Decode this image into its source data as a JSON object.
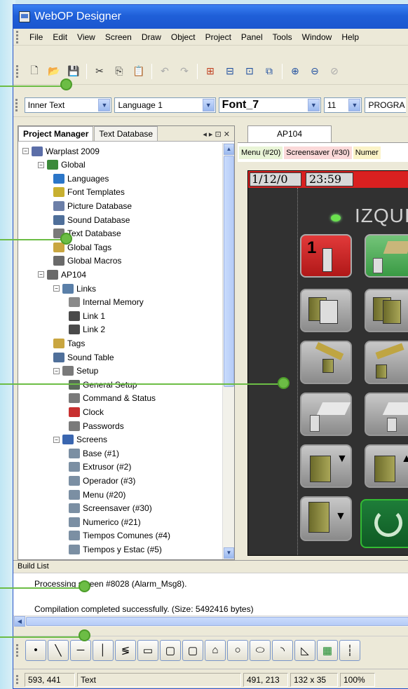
{
  "window": {
    "title": "WebOP Designer"
  },
  "menu": [
    "File",
    "Edit",
    "View",
    "Screen",
    "Draw",
    "Object",
    "Project",
    "Panel",
    "Tools",
    "Window",
    "Help"
  ],
  "format_toolbar": {
    "field_combo": "Inner Text",
    "language_combo": "Language 1",
    "font_combo": "Font_7",
    "size_combo": "11",
    "extra_combo": "PROGRA"
  },
  "project_manager": {
    "tabs": [
      "Project Manager",
      "Text Database"
    ],
    "controls": "◂ ▸ ⊡ ✕",
    "tree": [
      {
        "label": "Warplast 2009",
        "level": 0,
        "expander": "−",
        "icon_color": "#5b6ea8"
      },
      {
        "label": "Global",
        "level": 1,
        "expander": "−",
        "icon_color": "#3b8a3a"
      },
      {
        "label": "Languages",
        "level": 2,
        "expander": "",
        "icon_color": "#2b76c8"
      },
      {
        "label": "Font Templates",
        "level": 2,
        "expander": "",
        "icon_color": "#c8b030"
      },
      {
        "label": "Picture Database",
        "level": 2,
        "expander": "",
        "icon_color": "#6c7fa8"
      },
      {
        "label": "Sound Database",
        "level": 2,
        "expander": "",
        "icon_color": "#4f6f9a"
      },
      {
        "label": "Text Database",
        "level": 2,
        "expander": "",
        "icon_color": "#7a7a7a"
      },
      {
        "label": "Global Tags",
        "level": 2,
        "expander": "",
        "icon_color": "#c9a640"
      },
      {
        "label": "Global Macros",
        "level": 2,
        "expander": "",
        "icon_color": "#6a6a6a"
      },
      {
        "label": "AP104",
        "level": 1,
        "expander": "−",
        "icon_color": "#6a6a6a"
      },
      {
        "label": "Links",
        "level": 2,
        "expander": "−",
        "icon_color": "#5a7fa8"
      },
      {
        "label": "Internal Memory",
        "level": 3,
        "expander": "",
        "icon_color": "#8a8a8a"
      },
      {
        "label": "Link 1",
        "level": 3,
        "expander": "",
        "icon_color": "#4a4a4a"
      },
      {
        "label": "Link 2",
        "level": 3,
        "expander": "",
        "icon_color": "#4a4a4a"
      },
      {
        "label": "Tags",
        "level": 2,
        "expander": "",
        "icon_color": "#c9a640"
      },
      {
        "label": "Sound Table",
        "level": 2,
        "expander": "",
        "icon_color": "#4f6f9a"
      },
      {
        "label": "Setup",
        "level": 2,
        "expander": "−",
        "icon_color": "#7a7a7a"
      },
      {
        "label": "General Setup",
        "level": 3,
        "expander": "",
        "icon_color": "#5a6a5a"
      },
      {
        "label": "Command & Status",
        "level": 3,
        "expander": "",
        "icon_color": "#7a7a7a"
      },
      {
        "label": "Clock",
        "level": 3,
        "expander": "",
        "icon_color": "#c83030"
      },
      {
        "label": "Passwords",
        "level": 3,
        "expander": "",
        "icon_color": "#7a7a7a"
      },
      {
        "label": "Screens",
        "level": 2,
        "expander": "−",
        "icon_color": "#3a66b0"
      },
      {
        "label": "Base (#1)",
        "level": 3,
        "expander": "",
        "icon_color": "#7b8fa3"
      },
      {
        "label": "Extrusor (#2)",
        "level": 3,
        "expander": "",
        "icon_color": "#7b8fa3"
      },
      {
        "label": "Operador (#3)",
        "level": 3,
        "expander": "",
        "icon_color": "#7b8fa3"
      },
      {
        "label": "Menu (#20)",
        "level": 3,
        "expander": "",
        "icon_color": "#7b8fa3"
      },
      {
        "label": "Screensaver (#30)",
        "level": 3,
        "expander": "",
        "icon_color": "#7b8fa3"
      },
      {
        "label": "Numerico (#21)",
        "level": 3,
        "expander": "",
        "icon_color": "#7b8fa3"
      },
      {
        "label": "Tiempos Comunes (#4)",
        "level": 3,
        "expander": "",
        "icon_color": "#7b8fa3"
      },
      {
        "label": "Tiempos y Estac (#5)",
        "level": 3,
        "expander": "",
        "icon_color": "#7b8fa3"
      }
    ]
  },
  "editor": {
    "doc_tab": "AP104",
    "screen_tabs": [
      {
        "label": "Menu (#20)",
        "color": "#e9f5d7"
      },
      {
        "label": "Screensaver (#30)",
        "color": "#fbd9d9"
      },
      {
        "label": "Numer",
        "color": "#fbf3c7"
      }
    ],
    "panel": {
      "date": "1/12/0",
      "time": "23:59",
      "label": "IZQUIE"
    }
  },
  "build_list": {
    "header": "Build List",
    "lines": [
      "Processing screen #8028 (Alarm_Msg8).",
      "Compilation completed successfully. (Size: 5492416 bytes)"
    ]
  },
  "status_bar": {
    "cursor": "593, 441",
    "object_type": "Text",
    "position": "491, 213",
    "size": "132 x 35",
    "zoom": "100%"
  },
  "colors": {
    "callout": "#6cbd45",
    "titlebar": "#1f5fd8",
    "panel_alarm": "#d92020"
  }
}
